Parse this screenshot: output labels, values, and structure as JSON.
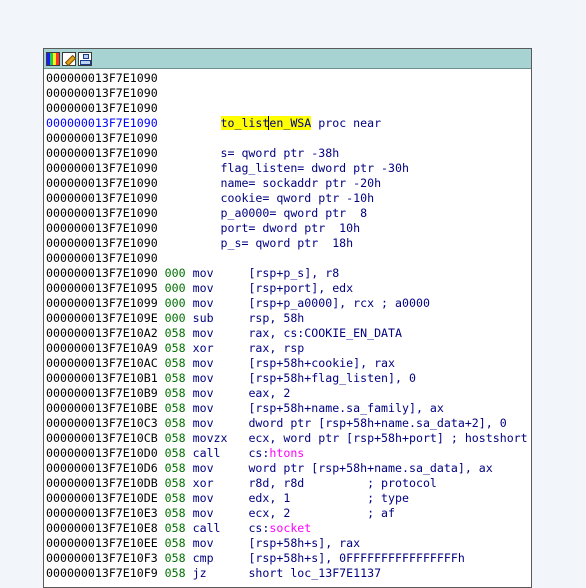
{
  "window": {
    "toolbar": [
      {
        "icon": "color-palette-icon"
      },
      {
        "icon": "edit-pencil-icon"
      },
      {
        "icon": "graph-view-icon"
      }
    ]
  },
  "colors": {
    "address": "#000000",
    "address_highlight": "#0000ff",
    "stack_pointer": "#007000",
    "mnemonic": "#000080",
    "function_ref": "#ff00ff",
    "highlight": "#ffff00",
    "title_bar": "#a8d3d3"
  },
  "lines": [
    {
      "addr": "000000013F7E1090",
      "text": ""
    },
    {
      "addr": "000000013F7E1090",
      "text": ""
    },
    {
      "addr": "000000013F7E1090",
      "text": ""
    },
    {
      "addr": "000000013F7E1090",
      "proc": {
        "name_a": "to_list",
        "name_b": "en_WSA",
        "rest": " proc near"
      }
    },
    {
      "addr": "000000013F7E1090",
      "text": ""
    },
    {
      "addr": "000000013F7E1090",
      "text": "s= qword ptr -38h"
    },
    {
      "addr": "000000013F7E1090",
      "text": "flag_listen= dword ptr -30h"
    },
    {
      "addr": "000000013F7E1090",
      "text": "name= sockaddr ptr -20h"
    },
    {
      "addr": "000000013F7E1090",
      "text": "cookie= qword ptr -10h"
    },
    {
      "addr": "000000013F7E1090",
      "text": "p_a0000= qword ptr  8"
    },
    {
      "addr": "000000013F7E1090",
      "text": "port= dword ptr  10h"
    },
    {
      "addr": "000000013F7E1090",
      "text": "p_s= qword ptr  18h"
    },
    {
      "addr": "000000013F7E1090",
      "text": ""
    },
    {
      "addr": "000000013F7E1090",
      "sp": "000",
      "mn": "mov",
      "op": "[rsp+p_s], r8"
    },
    {
      "addr": "000000013F7E1095",
      "sp": "000",
      "mn": "mov",
      "op": "[rsp+port], edx"
    },
    {
      "addr": "000000013F7E1099",
      "sp": "000",
      "mn": "mov",
      "op": "[rsp+p_a0000], rcx ; a0000"
    },
    {
      "addr": "000000013F7E109E",
      "sp": "000",
      "mn": "sub",
      "op": "rsp, 58h"
    },
    {
      "addr": "000000013F7E10A2",
      "sp": "058",
      "mn": "mov",
      "op": "rax, cs:COOKIE_EN_DATA"
    },
    {
      "addr": "000000013F7E10A9",
      "sp": "058",
      "mn": "xor",
      "op": "rax, rsp"
    },
    {
      "addr": "000000013F7E10AC",
      "sp": "058",
      "mn": "mov",
      "op": "[rsp+58h+cookie], rax"
    },
    {
      "addr": "000000013F7E10B1",
      "sp": "058",
      "mn": "mov",
      "op": "[rsp+58h+flag_listen], 0"
    },
    {
      "addr": "000000013F7E10B9",
      "sp": "058",
      "mn": "mov",
      "op": "eax, 2"
    },
    {
      "addr": "000000013F7E10BE",
      "sp": "058",
      "mn": "mov",
      "op": "[rsp+58h+name.sa_family], ax"
    },
    {
      "addr": "000000013F7E10C3",
      "sp": "058",
      "mn": "mov",
      "op": "dword ptr [rsp+58h+name.sa_data+2], 0"
    },
    {
      "addr": "000000013F7E10CB",
      "sp": "058",
      "mn": "movzx",
      "op": "ecx, word ptr [rsp+58h+port] ; hostshort"
    },
    {
      "addr": "000000013F7E10D0",
      "sp": "058",
      "mn": "call",
      "op_pre": "cs:",
      "op_fn": "htons"
    },
    {
      "addr": "000000013F7E10D6",
      "sp": "058",
      "mn": "mov",
      "op": "word ptr [rsp+58h+name.sa_data], ax"
    },
    {
      "addr": "000000013F7E10DB",
      "sp": "058",
      "mn": "xor",
      "op": "r8d, r8d         ; protocol"
    },
    {
      "addr": "000000013F7E10DE",
      "sp": "058",
      "mn": "mov",
      "op": "edx, 1           ; type"
    },
    {
      "addr": "000000013F7E10E3",
      "sp": "058",
      "mn": "mov",
      "op": "ecx, 2           ; af"
    },
    {
      "addr": "000000013F7E10E8",
      "sp": "058",
      "mn": "call",
      "op_pre": "cs:",
      "op_fn": "socket"
    },
    {
      "addr": "000000013F7E10EE",
      "sp": "058",
      "mn": "mov",
      "op": "[rsp+58h+s], rax"
    },
    {
      "addr": "000000013F7E10F3",
      "sp": "058",
      "mn": "cmp",
      "op": "[rsp+58h+s], 0FFFFFFFFFFFFFFFFh"
    },
    {
      "addr": "000000013F7E10F9",
      "sp": "058",
      "mn": "jz",
      "op": "short loc_13F7E1137"
    }
  ]
}
